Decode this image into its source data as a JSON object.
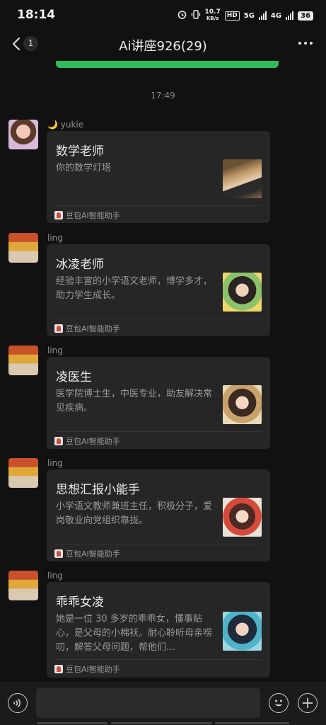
{
  "status_bar": {
    "time": "18:14",
    "net_speed_value": "10.7",
    "net_speed_unit": "KB/s",
    "hd_label": "HD",
    "network_5g": "5G",
    "network_4g": "4G",
    "battery": "36"
  },
  "navbar": {
    "unread_count": "1",
    "title": "Ai讲座926(29)",
    "more": "···"
  },
  "timestamp": "17:49",
  "messages": [
    {
      "sender": "🌙 yukie",
      "title": "数学老师",
      "desc": "你的数学灯塔",
      "source": "豆包AI智能助手"
    },
    {
      "sender": "ling",
      "title": "冰凌老师",
      "desc": "经验丰富的小学语文老师，博学多才，助力学生成长。",
      "source": "豆包AI智能助手"
    },
    {
      "sender": "ling",
      "title": "凌医生",
      "desc": "医学院博士生，中医专业，助友解决常见疾病。",
      "source": "豆包AI智能助手"
    },
    {
      "sender": "ling",
      "title": "思想汇报小能手",
      "desc": "小学语文教师兼班主任，积极分子，爱岗敬业向党组织靠拢。",
      "source": "豆包AI智能助手"
    },
    {
      "sender": "ling",
      "title": "乖乖女凌",
      "desc": "她是一位 30 多岁的乖乖女，懂事贴心，是父母的小棉袄。耐心聆听母亲唠叨，解答父母问题，帮他们…",
      "source": "豆包AI智能助手"
    }
  ],
  "icons": {
    "back": "back-chevron-icon",
    "more": "more-dots-icon",
    "voice": "voice-icon",
    "emoji": "emoji-icon",
    "plus": "plus-icon"
  }
}
